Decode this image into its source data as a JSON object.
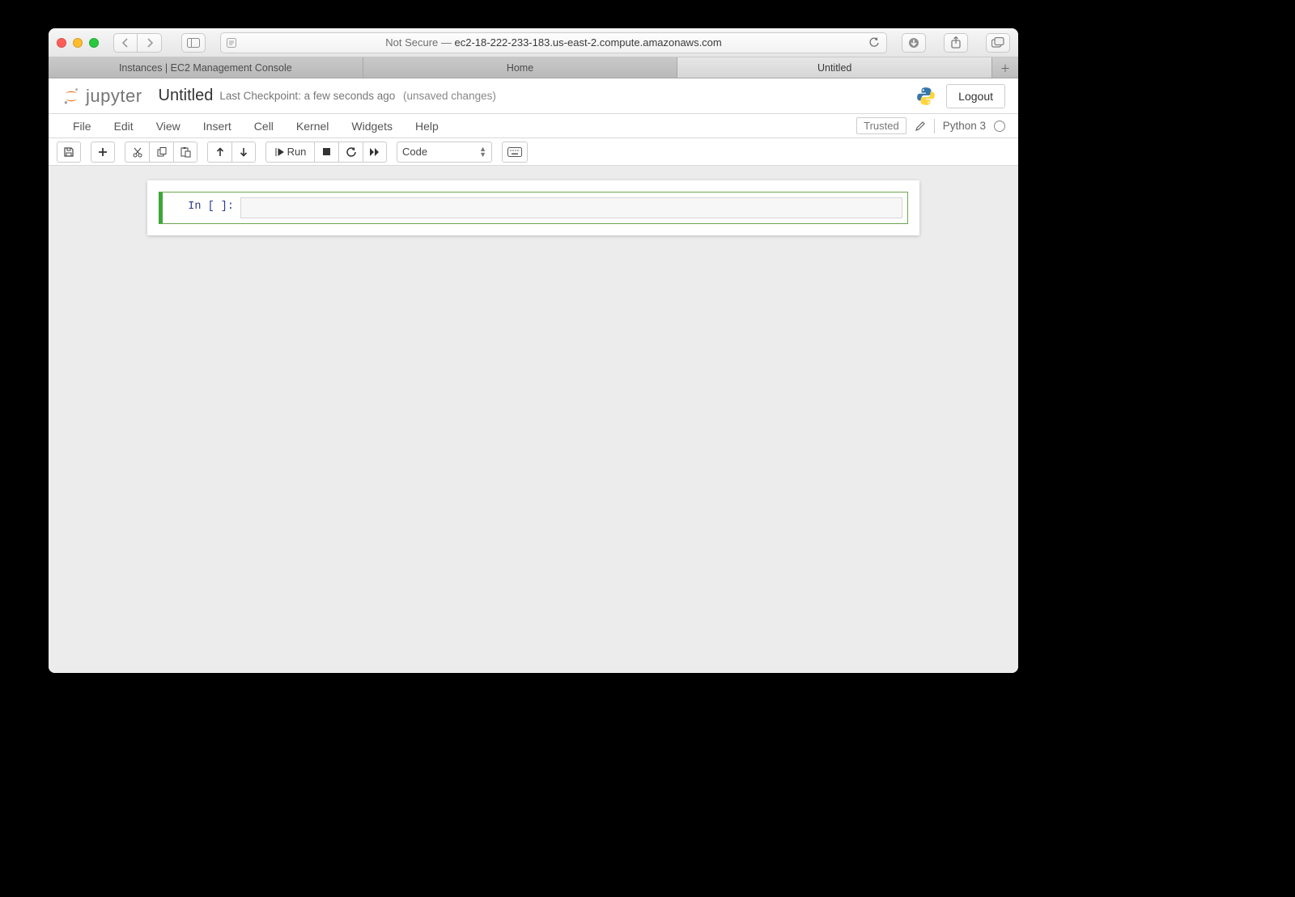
{
  "browser": {
    "url_prefix": "Not Secure — ",
    "url_host": "ec2-18-222-233-183.us-east-2.compute.amazonaws.com",
    "tabs": [
      {
        "label": "Instances | EC2 Management Console",
        "active": false
      },
      {
        "label": "Home",
        "active": false
      },
      {
        "label": "Untitled",
        "active": true
      }
    ]
  },
  "header": {
    "logo_text": "jupyter",
    "notebook_title": "Untitled",
    "checkpoint_text": "Last Checkpoint: a few seconds ago",
    "unsaved_text": "(unsaved changes)",
    "logout_label": "Logout"
  },
  "menubar": {
    "items": [
      "File",
      "Edit",
      "View",
      "Insert",
      "Cell",
      "Kernel",
      "Widgets",
      "Help"
    ],
    "trusted_label": "Trusted",
    "kernel_name": "Python 3"
  },
  "toolbar": {
    "run_label": "Run",
    "cell_type_selected": "Code"
  },
  "notebook": {
    "cells": [
      {
        "prompt": "In [ ]:",
        "source": ""
      }
    ]
  }
}
